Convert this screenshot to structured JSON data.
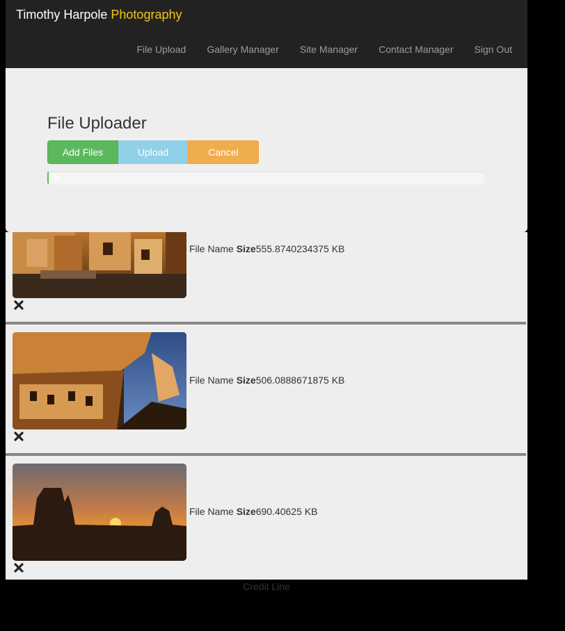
{
  "brand": {
    "name": "Timothy Harpole",
    "accent": "Photography"
  },
  "nav": [
    {
      "label": "File Upload"
    },
    {
      "label": "Gallery Manager"
    },
    {
      "label": "Site Manager"
    },
    {
      "label": "Contact Manager"
    },
    {
      "label": "Sign Out"
    }
  ],
  "uploader": {
    "title": "File Uploader",
    "add_label": "Add Files",
    "upload_label": "Upload",
    "cancel_label": "Cancel",
    "progress_text": "0%",
    "progress_value": 0
  },
  "files": [
    {
      "name_label": "File Name",
      "size_label": "Size",
      "size": "555.8740234375 KB"
    },
    {
      "name_label": "File Name",
      "size_label": "Size",
      "size": "506.0888671875 KB"
    },
    {
      "name_label": "File Name",
      "size_label": "Size",
      "size": "690.40625 KB"
    }
  ],
  "footer": {
    "credit": "Credit Line"
  },
  "colors": {
    "accent": "#f5c518",
    "success": "#5cb85c",
    "info": "#91d0e6",
    "warning": "#f0ad4e"
  }
}
